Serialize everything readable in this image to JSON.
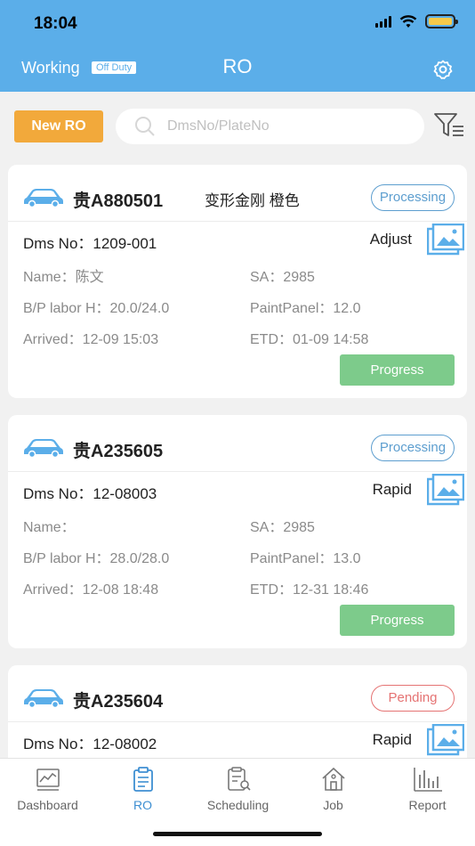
{
  "status_bar": {
    "time": "18:04"
  },
  "header": {
    "working": "Working",
    "off_duty": "Off Duty",
    "title": "RO"
  },
  "toolbar": {
    "new_ro_label": "New RO",
    "search_placeholder": "DmsNo/PlateNo"
  },
  "cards": [
    {
      "plate": "贵A880501",
      "model": "变形金刚 橙色",
      "status": "Processing",
      "dms_no": "Dms No：1209-001",
      "type": "Adjust",
      "name": "Name：陈文",
      "sa": "SA：2985",
      "labor": "B/P labor H：20.0/24.0",
      "paint": "PaintPanel：12.0",
      "arrived": "Arrived：12-09 15:03",
      "etd": "ETD：01-09 14:58",
      "progress_label": "Progress"
    },
    {
      "plate": "贵A235605",
      "model": "",
      "status": "Processing",
      "dms_no": "Dms No：12-08003",
      "type": "Rapid",
      "name": "Name：",
      "sa": "SA：2985",
      "labor": "B/P labor H：28.0/28.0",
      "paint": "PaintPanel：13.0",
      "arrived": "Arrived：12-08 18:48",
      "etd": "ETD：12-31 18:46",
      "progress_label": "Progress"
    },
    {
      "plate": "贵A235604",
      "model": "",
      "status": "Pending",
      "dms_no": "Dms No：12-08002",
      "type": "Rapid"
    }
  ],
  "nav": [
    {
      "label": "Dashboard",
      "icon": "dashboard-icon"
    },
    {
      "label": "RO",
      "icon": "clipboard-icon",
      "active": true
    },
    {
      "label": "Scheduling",
      "icon": "scheduling-icon"
    },
    {
      "label": "Job",
      "icon": "house-icon"
    },
    {
      "label": "Report",
      "icon": "report-icon"
    }
  ],
  "colors": {
    "header_blue": "#5baee9",
    "new_ro_orange": "#f2a93b",
    "progress_green": "#7dcb8b",
    "processing_blue": "#5d9ecf",
    "pending_red": "#e57373",
    "active_nav": "#3e8fd2"
  }
}
